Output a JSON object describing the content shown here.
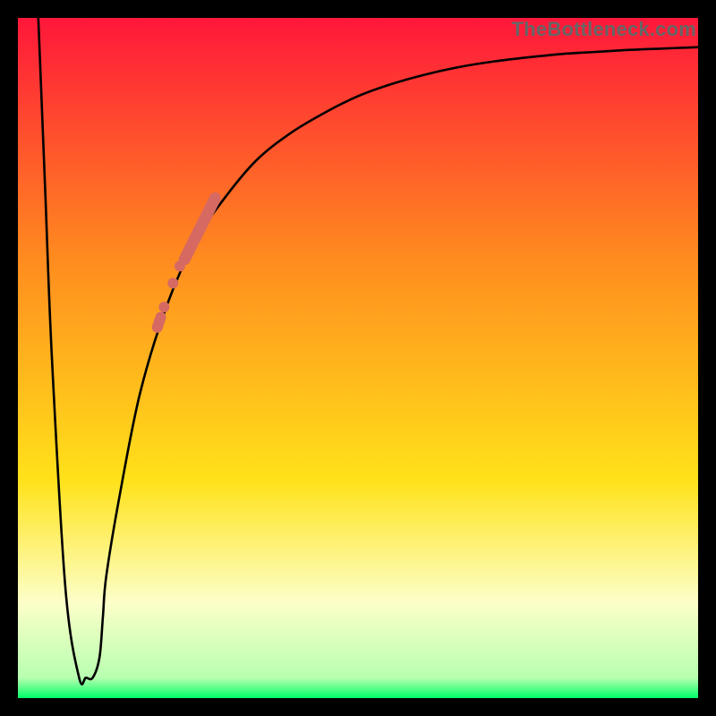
{
  "watermark": "TheBottleneck.com",
  "colors": {
    "gradient_top": "#ff173a",
    "gradient_mid1": "#ff8a1f",
    "gradient_mid2": "#ffe21a",
    "gradient_pale": "#fcffc9",
    "gradient_green": "#00ff66",
    "curve": "#000000",
    "marker": "#d66a62",
    "marker_stroke": "#bd574f"
  },
  "chart_data": {
    "type": "line",
    "title": "",
    "xlabel": "",
    "ylabel": "",
    "xlim": [
      0,
      100
    ],
    "ylim": [
      0,
      100
    ],
    "series": [
      {
        "name": "bottleneck-curve",
        "x": [
          3,
          4,
          5,
          7,
          9,
          10,
          11,
          12,
          12.5,
          13,
          15,
          18,
          22,
          26,
          30,
          35,
          40,
          45,
          50,
          55,
          60,
          65,
          70,
          75,
          80,
          85,
          90,
          95,
          100
        ],
        "y": [
          100,
          75,
          50,
          16,
          3,
          3,
          3,
          6,
          12,
          18,
          30,
          45,
          58,
          67,
          73,
          79,
          83,
          86,
          88.5,
          90.3,
          91.7,
          92.8,
          93.6,
          94.2,
          94.7,
          95,
          95.3,
          95.5,
          95.7
        ]
      }
    ],
    "markers": {
      "name": "highlighted-points",
      "points": [
        {
          "x": 21.5,
          "y": 57.5,
          "r": 6
        },
        {
          "x": 22.8,
          "y": 61.0,
          "r": 6
        },
        {
          "x": 23.8,
          "y": 63.5,
          "r": 6
        }
      ],
      "segment": {
        "x1": 20.5,
        "y1": 54.5,
        "x2": 21.0,
        "y2": 56.0
      },
      "big_segment": {
        "x1": 24.5,
        "y1": 64.5,
        "x2": 29.0,
        "y2": 73.5
      }
    }
  }
}
